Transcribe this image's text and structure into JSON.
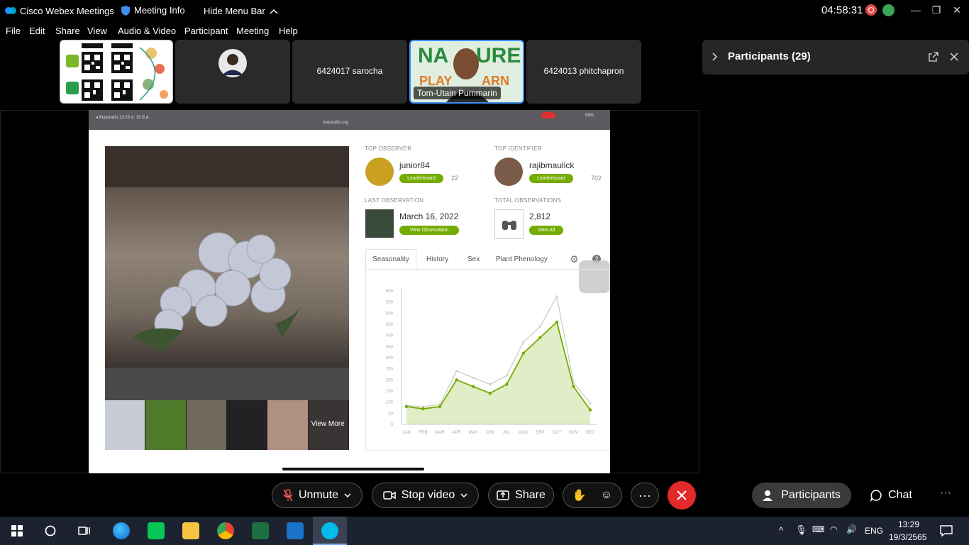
{
  "titlebar": {
    "app_title": "Cisco Webex Meetings",
    "meeting_info": "Meeting Info",
    "hide_menu": "Hide Menu Bar",
    "clock": "04:58:31"
  },
  "menu": [
    "File",
    "Edit",
    "Share",
    "View",
    "Audio & Video",
    "Participant",
    "Meeting",
    "Help"
  ],
  "thumbnails": {
    "sarocha": "6424017 sarocha",
    "active_speaker": "Tom-Utain Pummarin",
    "phitchapron": "6424013 phitchapron"
  },
  "participants_panel": {
    "title": "Participants (29)"
  },
  "shared": {
    "top_observer_label": "TOP OBSERVER",
    "top_observer": "junior84",
    "top_observer_count": "22",
    "top_identifier_label": "TOP IDENTIFIER",
    "top_identifier": "rajibmaulick",
    "top_identifier_count": "702",
    "leaderboard": "Leaderboard",
    "last_obs_label": "LAST OBSERVATION",
    "last_obs_date": "March 16, 2022",
    "view_observation": "View Observation",
    "total_obs_label": "TOTAL OBSERVATIONS",
    "total_obs": "2,812",
    "view_all": "View All",
    "view_more": "View More",
    "tabs": [
      "Seasonality",
      "History",
      "Sex",
      "Plant Phenology"
    ],
    "status_left": "◂ iNaturalist  13:29  ส. 19 มี.ค.",
    "status_url": "inaturalist.org",
    "status_right": "89%"
  },
  "chart_data": {
    "type": "area",
    "categories": [
      "JAN",
      "FEB",
      "MAR",
      "APR",
      "MAY",
      "JUN",
      "JUL",
      "AUG",
      "SEP",
      "OCT",
      "NOV",
      "DEC"
    ],
    "series": [
      {
        "values": [
          80,
          70,
          80,
          200,
          170,
          140,
          180,
          320,
          390,
          460,
          170,
          65
        ]
      },
      {
        "values": [
          85,
          80,
          90,
          240,
          210,
          180,
          220,
          370,
          440,
          575,
          190,
          95
        ]
      }
    ],
    "yticks": [
      0,
      50,
      100,
      150,
      200,
      250,
      300,
      350,
      400,
      450,
      500,
      550,
      600
    ],
    "ylim": [
      0,
      600
    ]
  },
  "controls": {
    "unmute": "Unmute",
    "stop_video": "Stop video",
    "share": "Share",
    "participants": "Participants",
    "chat": "Chat"
  },
  "taskbar": {
    "lang": "ENG",
    "time": "13:29",
    "date": "19/3/2565"
  }
}
